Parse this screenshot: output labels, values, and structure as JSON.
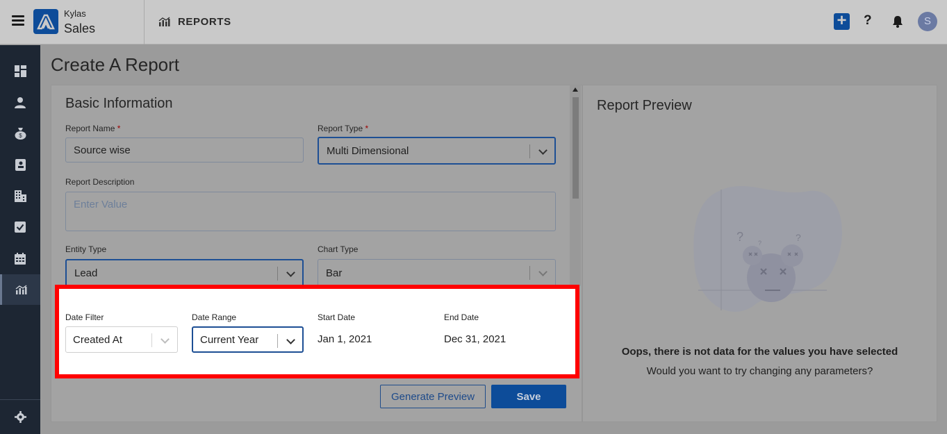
{
  "header": {
    "brand_line1": "Kylas",
    "brand_line2": "Sales",
    "section_title": "REPORTS",
    "help_glyph": "?",
    "add_glyph": "+",
    "avatar_initial": "S"
  },
  "sidebar": {
    "items": [
      {
        "icon": "dashboard-icon"
      },
      {
        "icon": "person-icon"
      },
      {
        "icon": "money-bag-icon"
      },
      {
        "icon": "contact-book-icon"
      },
      {
        "icon": "building-icon"
      },
      {
        "icon": "checkbox-icon"
      },
      {
        "icon": "calendar-icon"
      },
      {
        "icon": "reports-icon"
      }
    ],
    "settings_icon": "gear-icon"
  },
  "page": {
    "title": "Create A Report"
  },
  "form": {
    "section_title": "Basic Information",
    "report_name": {
      "label": "Report Name",
      "required_mark": "*",
      "value": "Source wise"
    },
    "report_type": {
      "label": "Report Type",
      "required_mark": "*",
      "value": "Multi Dimensional"
    },
    "report_description": {
      "label": "Report Description",
      "placeholder": "Enter Value"
    },
    "entity_type": {
      "label": "Entity Type",
      "value": "Lead"
    },
    "chart_type": {
      "label": "Chart Type",
      "value": "Bar"
    },
    "date_filter": {
      "label": "Date Filter",
      "value": "Created At"
    },
    "date_range": {
      "label": "Date Range",
      "value": "Current Year"
    },
    "start_date": {
      "label": "Start Date",
      "value": "Jan 1, 2021"
    },
    "end_date": {
      "label": "End Date",
      "value": "Dec 31, 2021"
    },
    "generate_preview_label": "Generate Preview",
    "save_label": "Save"
  },
  "preview": {
    "title": "Report Preview",
    "empty_message": "Oops, there is not data for the values you have selected",
    "empty_hint": "Would you want to try changing any parameters?"
  },
  "colors": {
    "brand": "#0d4c99",
    "highlight_border": "#ff0000",
    "sidebar_bg": "#1d2633"
  }
}
